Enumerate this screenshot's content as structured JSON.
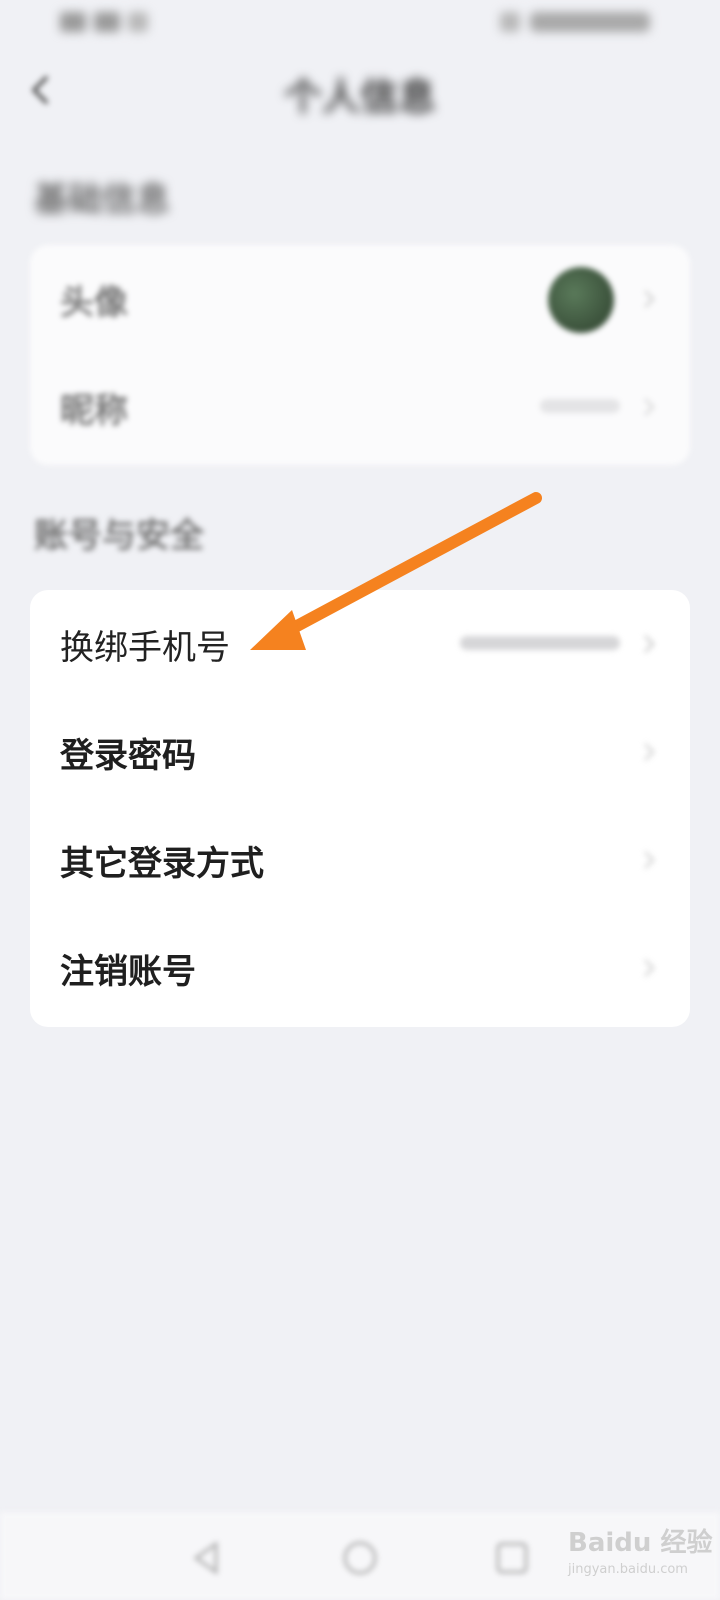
{
  "nav": {
    "title": "个人信息"
  },
  "sections": {
    "basic": {
      "header": "基础信息",
      "rows": [
        {
          "label": "头像"
        },
        {
          "label": "昵称"
        }
      ]
    },
    "account": {
      "header": "账号与安全",
      "rows": [
        {
          "label": "换绑手机号"
        },
        {
          "label": "登录密码"
        },
        {
          "label": "其它登录方式"
        },
        {
          "label": "注销账号"
        }
      ]
    }
  },
  "annotation": {
    "arrow_color": "#f5821f"
  },
  "watermark": {
    "brand": "Baidu 经验",
    "url": "jingyan.baidu.com"
  },
  "icons": {
    "back": "chevron-left-icon",
    "row_chevron": "chevron-right-icon",
    "sys_back": "triangle-back-icon",
    "sys_home": "circle-home-icon",
    "sys_recent": "square-recent-icon"
  }
}
